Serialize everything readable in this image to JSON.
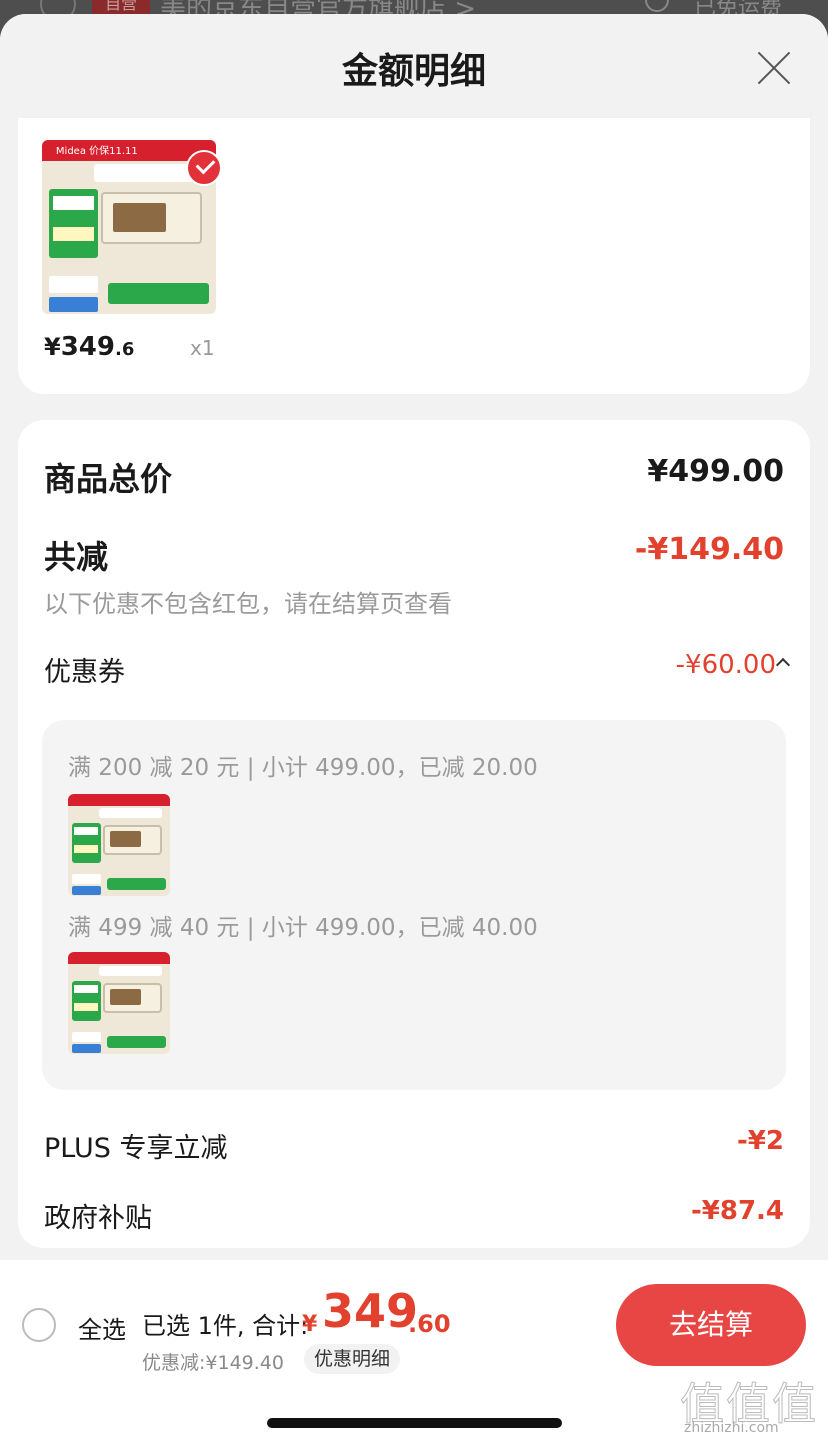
{
  "underlay": {
    "badge": "自营",
    "store_name": "美的京东自营官方旗舰店 >",
    "shipping": "已免运费"
  },
  "sheet": {
    "title": "金额明细"
  },
  "product": {
    "thumb_brand": "Midea  价保11.11",
    "price_symbol": "¥",
    "price_int": "349",
    "price_dec": ".6",
    "quantity": "x1"
  },
  "details": {
    "total_label": "商品总价",
    "total_amount": "¥499.00",
    "reduce_label": "共减",
    "reduce_amount": "-¥149.40",
    "reduce_note": "以下优惠不包含红包，请在结算页查看",
    "coupon_label": "优惠券",
    "coupon_amount": "-¥60.00",
    "coupons": [
      {
        "text": "满 200 减 20 元 | 小计 499.00，已减 20.00"
      },
      {
        "text": "满 499 减 40 元 | 小计 499.00，已减 40.00"
      }
    ],
    "plus_label": "PLUS 专享立减",
    "plus_amount": "-¥2",
    "gov_label": "政府补贴",
    "gov_amount": "-¥87.4"
  },
  "footer": {
    "select_all": "全选",
    "selected_count": "已选 1件, 合计:",
    "total_symbol": "¥",
    "total_int": "349",
    "total_dec": ".60",
    "discount_text": "优惠减:¥149.40",
    "discount_detail_link": "优惠明细",
    "checkout_button": "去结算"
  },
  "watermark": {
    "glyphs": "值值值",
    "site": "zhizhizhi.com"
  },
  "colors": {
    "accent_red": "#e2412e",
    "checkout_red": "#e84545",
    "sheet_bg": "#f2f2f2"
  }
}
